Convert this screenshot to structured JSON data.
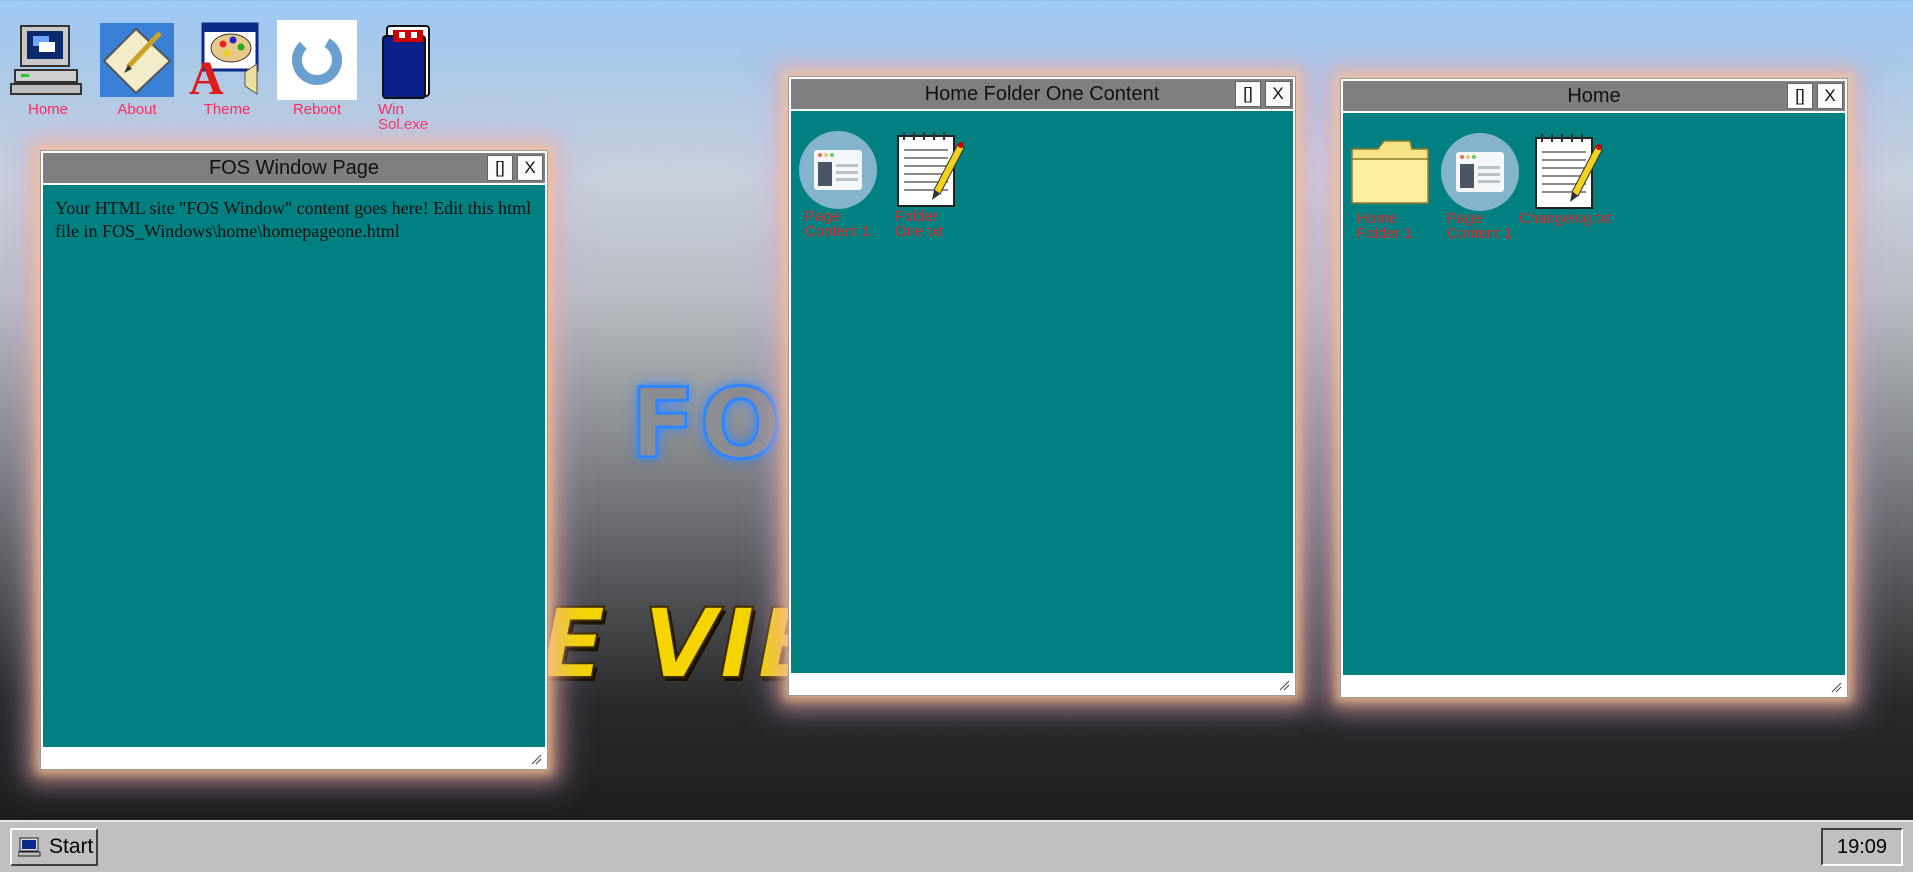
{
  "desktop": {
    "icons": [
      {
        "label": "Home",
        "icon": "computer-icon"
      },
      {
        "label": "About",
        "icon": "about-icon"
      },
      {
        "label": "Theme",
        "icon": "theme-palette-icon"
      },
      {
        "label": "Reboot",
        "icon": "reboot-icon"
      },
      {
        "label": "Win Sol.exe",
        "icon": "solitaire-icon"
      }
    ],
    "background_text_1": "FO",
    "background_text_2": "E VIE"
  },
  "windows": {
    "fos_page": {
      "title": "FOS Window Page",
      "maximize_label": "[]",
      "close_label": "X",
      "content_text": "Your HTML site \"FOS Window\" content goes here! Edit this html file in FOS_Windows\\home\\homepageone.html"
    },
    "folder_one": {
      "title": "Home Folder One Content",
      "maximize_label": "[]",
      "close_label": "X",
      "items": [
        {
          "label": "Page Content 1",
          "icon": "web-page-icon"
        },
        {
          "label": "Folder One.txt",
          "icon": "notepad-icon"
        }
      ]
    },
    "home": {
      "title": "Home",
      "maximize_label": "[]",
      "close_label": "X",
      "items": [
        {
          "label": "Home Folder 1",
          "icon": "folder-icon"
        },
        {
          "label": "Page Content 1",
          "icon": "web-page-icon"
        },
        {
          "label": "Changelog.txt",
          "icon": "notepad-icon"
        }
      ]
    }
  },
  "taskbar": {
    "start_label": "Start",
    "clock": "19:09"
  },
  "colors": {
    "window_content": "#008080",
    "titlebar": "#7f7f7f",
    "desktop_label": "#ff2a5c",
    "file_label": "#e0282a",
    "taskbar": "#c0c0c0"
  }
}
